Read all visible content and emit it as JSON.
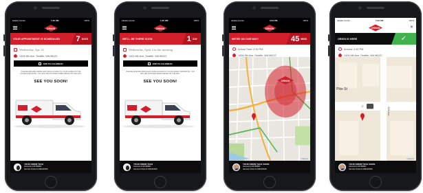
{
  "screens": [
    {
      "status": {
        "carrier": "●●●●● Carrier",
        "time": "1:45 PM",
        "battery": "100%"
      },
      "logo": "ORKIN",
      "banner": {
        "text": "YOUR APPOINTMENT IS SCHEDULED",
        "count": "7",
        "unit": "DAYS"
      },
      "date_text": "Wednesday, Apr 14",
      "address": "1404 6th Ave, Seattle, WA 98122",
      "calendar_button": "ADD TO CALENDAR",
      "note": "PLEASE ENSURE ORKIN HAS SAFE ACCESS TO YOUR HOME ON THE SCHEDULED DATE. YOU WILL BE NOTIFIED WHEN WE'RE ON THE WAY.",
      "see_you": "SEE YOU SOON!",
      "tech": {
        "title": "YOUR ORKIN TECH",
        "account": "Account # 04784567",
        "ticket": "Service Ticket # 230246645"
      }
    },
    {
      "status": {
        "carrier": "●●●●● Carrier",
        "time": "1:45 PM",
        "battery": "100%"
      },
      "logo": "ORKIN",
      "banner": {
        "text": "WE'LL BE THERE SOON",
        "count": "1",
        "unit": "DAY"
      },
      "date_text": "Wednesday, April 4 in the morning",
      "address": "1404 6th Ave, Seattle, WA 98122",
      "calendar_button": "ADD TO CALENDAR",
      "note": "PLEASE ENSURE ORKIN HAS SAFE ACCESS TO YOUR HOME TOMORROW. YOU WILL BE NOTIFIED WHEN WE'RE ON THE WAY.",
      "see_you": "SEE YOU SOON!",
      "tech": {
        "title": "YOUR ORKIN TECH",
        "account": "Account # 04784567",
        "ticket": "Service Ticket # 230246645"
      }
    },
    {
      "status": {
        "carrier": "●●●●● Carrier",
        "time": "2:04 PM",
        "battery": "100%"
      },
      "logo": "ORKIN",
      "banner": {
        "text": "WE'RE ON OUR WAY!",
        "count": "45",
        "unit": "MINS"
      },
      "arrival": "Arrival Time: 2:30 PM",
      "address": "1404 6th Ave, Seattle, WA 98122",
      "map_badge": "ORKIN",
      "map_credit": "mapbox",
      "tech": {
        "title": "YOUR ORKIN TECH CHRIS",
        "account": "Account # 04784567",
        "ticket": "Service Ticket # 230246645"
      }
    },
    {
      "status": {
        "carrier": "●●●●● Carrier",
        "time": "2:30 PM",
        "battery": "100%"
      },
      "logo": "ORKIN",
      "banner": {
        "text": "ORKIN IS HERE",
        "check": "✓"
      },
      "arrival": "Arrived: 2:30 PM",
      "address": "1404 6th Ave, Seattle, WA 98122",
      "street_label": "Pike St",
      "ave_label": "11th Ave",
      "map_credit": "mapbox",
      "tech": {
        "title": "YOUR ORKIN TECH CHRIS",
        "account": "Account # 04784567",
        "ticket": "Service Ticket # 230246645"
      }
    }
  ]
}
